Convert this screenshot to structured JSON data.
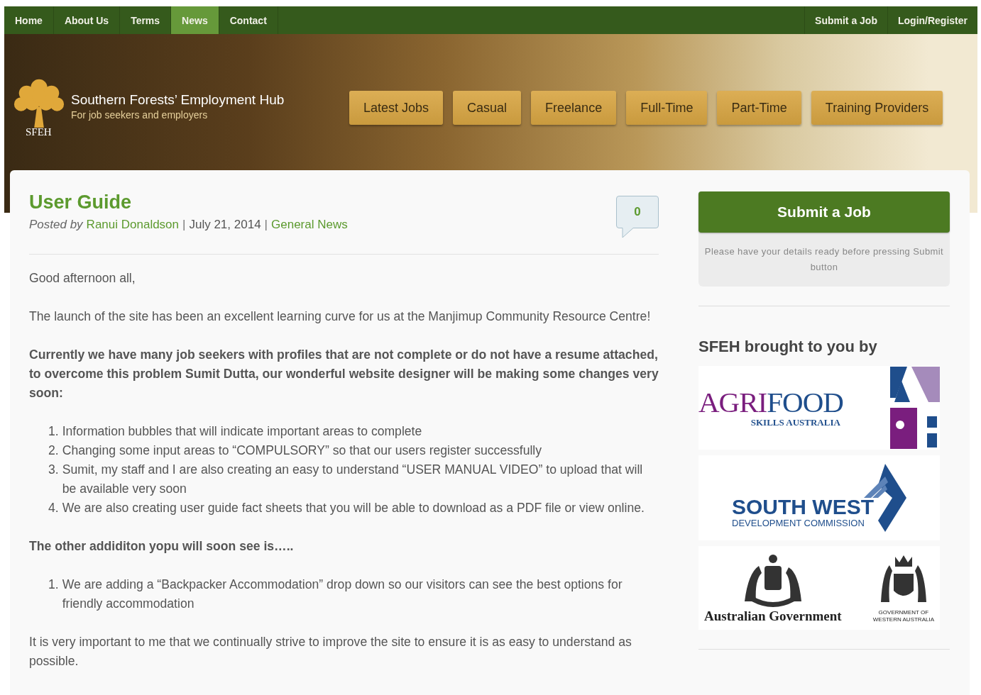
{
  "top_nav": {
    "items": [
      {
        "label": "Home",
        "selected": false
      },
      {
        "label": "About Us",
        "selected": false
      },
      {
        "label": "Terms",
        "selected": false
      },
      {
        "label": "News",
        "selected": true
      },
      {
        "label": "Contact",
        "selected": false
      }
    ],
    "right_links": [
      "Submit a Job",
      "Login/Register"
    ]
  },
  "header": {
    "site_title": "Southern Forests’ Employment Hub",
    "tagline": "For job seekers and employers",
    "logo_text": "SFEH",
    "categories": [
      "Latest Jobs",
      "Casual",
      "Freelance",
      "Full-Time",
      "Part-Time",
      "Training Providers"
    ]
  },
  "post": {
    "title": "User Guide",
    "meta": {
      "prefix": "Posted by",
      "separator": "|",
      "author": "Ranui Donaldson",
      "date": "July 21, 2014",
      "category": "General News"
    },
    "comment_count": "0",
    "body": [
      {
        "kind": "paragraph",
        "text": "Good afternoon all,"
      },
      {
        "kind": "paragraph",
        "text": "The launch of the site has been an excellent learning curve for us at the Manjimup Community Resource Centre!"
      },
      {
        "kind": "bold_paragraph",
        "text": "Currently we have many job seekers with profiles that are not complete or do not have a resume attached, to overcome this problem Sumit Dutta, our wonderful website designer will be making some changes very soon:"
      },
      {
        "kind": "list",
        "items": [
          {
            "number": "1.",
            "text": "Information bubbles that will indicate important areas to complete"
          },
          {
            "number": "2.",
            "text": "Changing some input areas to “COMPULSORY” so that our users register successfully"
          },
          {
            "number": "3.",
            "text": "Sumit, my staff and I are also creating an easy to understand “USER MANUAL VIDEO” to upload that will be available very soon"
          },
          {
            "number": "4.",
            "text": "We are also creating user guide fact sheets that you will be able to download as a PDF file or view online."
          }
        ]
      },
      {
        "kind": "bold_paragraph",
        "text": "The other addiditon yopu will soon see is….."
      },
      {
        "kind": "list",
        "items": [
          {
            "number": "1.",
            "text": "We are adding a “Backpacker Accommodation” drop down so our visitors can see the best options for friendly accommodation"
          }
        ]
      },
      {
        "kind": "paragraph",
        "text": "It is very important to me that we continually strive to improve the site to ensure it is as easy to understand as possible."
      }
    ]
  },
  "sidebar": {
    "submit_button": "Submit a Job",
    "submit_note": "Please have your details ready before pressing Submit button",
    "sponsors_heading": "SFEH brought to you by",
    "sponsors": [
      {
        "kind": "agrifood",
        "lines": [
          "AGRI",
          "FOOD",
          "SKILLS AUSTRALIA"
        ]
      },
      {
        "kind": "southwest",
        "lines": [
          "SOUTH WEST",
          "DEVELOPMENT COMMISSION"
        ]
      },
      {
        "kind": "government",
        "lines": [
          "Australian Government",
          "GOVERNMENT OF",
          "WESTERN AUSTRALIA"
        ]
      }
    ]
  }
}
